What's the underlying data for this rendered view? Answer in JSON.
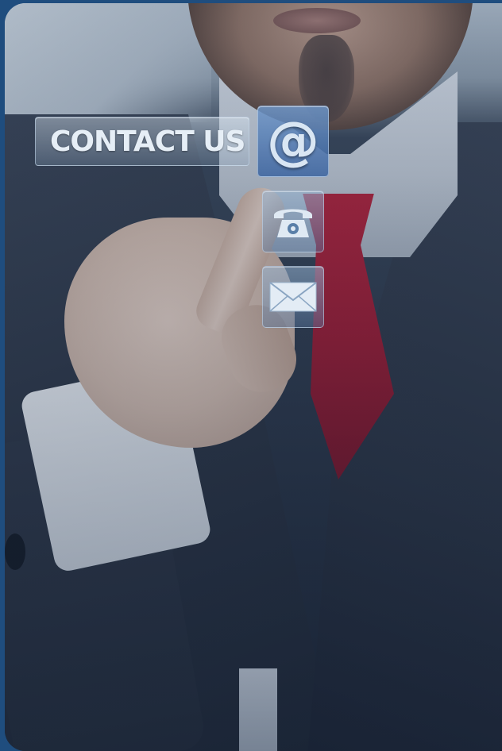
{
  "contact": {
    "label": "CONTACT US"
  },
  "icons": {
    "email": "at-sign-icon",
    "phone": "telephone-icon",
    "mail": "envelope-icon"
  },
  "colors": {
    "background": "#1f4d7e",
    "tie": "#a01d35",
    "label_text": "#e6eef6"
  }
}
